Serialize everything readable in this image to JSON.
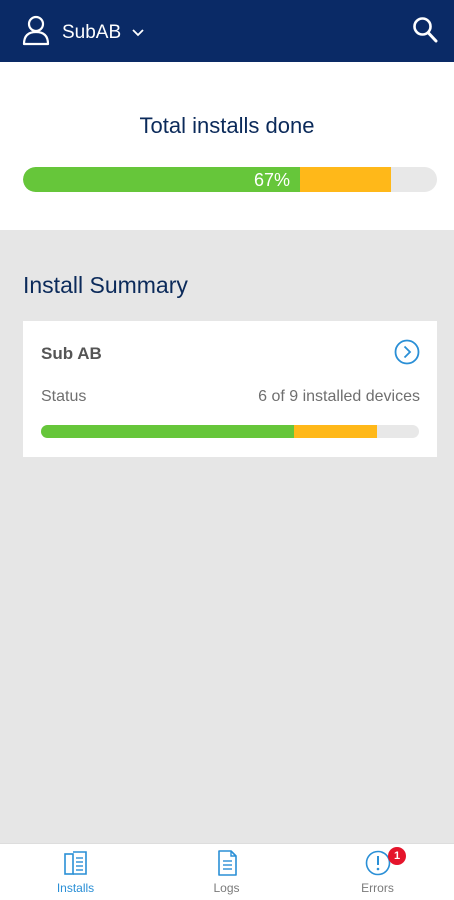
{
  "header": {
    "account_name": "SubAB",
    "colors": {
      "background": "#0a2a66"
    }
  },
  "summary": {
    "title": "Total installs done",
    "percent_label": "67%",
    "progress": {
      "installed_fraction": 0.67,
      "pending_fraction": 0.22
    }
  },
  "install_summary": {
    "title": "Install Summary",
    "cards": [
      {
        "name": "Sub AB",
        "status_label": "Status",
        "status_value": "6 of 9 installed devices",
        "progress": {
          "installed_fraction": 0.67,
          "pending_fraction": 0.22
        }
      }
    ]
  },
  "bottom_nav": {
    "items": [
      {
        "label": "Installs",
        "icon": "installs-icon",
        "active": true
      },
      {
        "label": "Logs",
        "icon": "logs-icon",
        "active": false
      },
      {
        "label": "Errors",
        "icon": "errors-icon",
        "active": false,
        "badge": "1"
      }
    ]
  },
  "colors": {
    "installed": "#66c63a",
    "pending": "#ffb819",
    "track": "#e8e8e8",
    "accent": "#2a8fd6",
    "badge": "#e5142b"
  }
}
